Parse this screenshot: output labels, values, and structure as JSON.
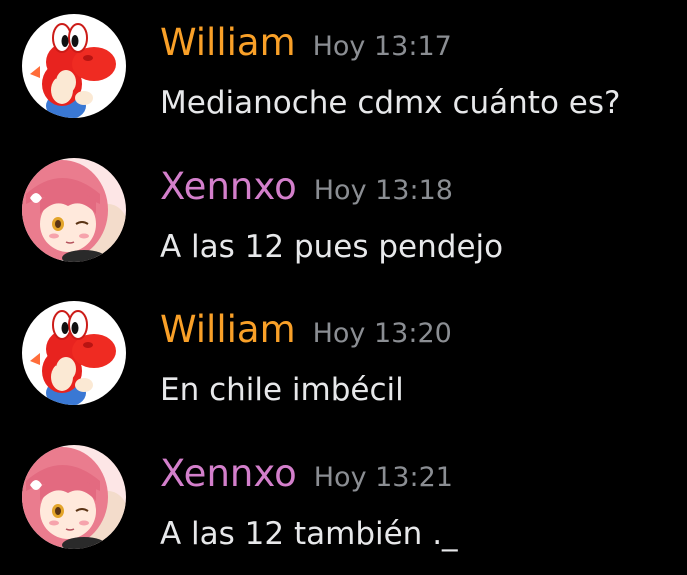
{
  "messages": [
    {
      "author": "William",
      "author_color": "#f9a028",
      "avatar": "red-yoshi-avatar",
      "timestamp": "Hoy 13:17",
      "text": "Medianoche cdmx cuánto es?"
    },
    {
      "author": "Xennxo",
      "author_color": "#d37fcb",
      "avatar": "pink-hair-anime-girl-avatar",
      "timestamp": "Hoy 13:18",
      "text": "A las 12 pues pendejo"
    },
    {
      "author": "William",
      "author_color": "#f9a028",
      "avatar": "red-yoshi-avatar",
      "timestamp": "Hoy 13:20",
      "text": "En chile imbécil"
    },
    {
      "author": "Xennxo",
      "author_color": "#d37fcb",
      "avatar": "pink-hair-anime-girl-avatar",
      "timestamp": "Hoy 13:21",
      "text": "A las 12 también ._"
    }
  ]
}
